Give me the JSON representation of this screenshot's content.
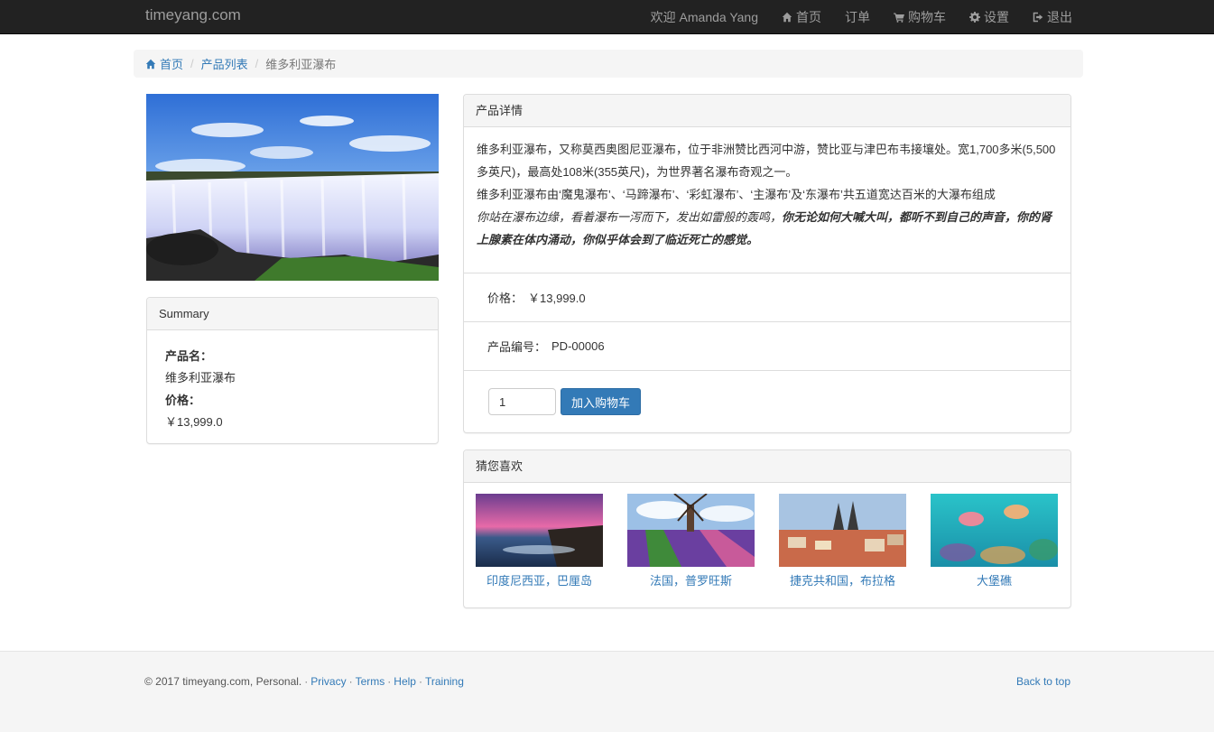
{
  "navbar": {
    "brand": "timeyang.com",
    "welcome": "欢迎 Amanda Yang",
    "home": "首页",
    "orders": "订单",
    "cart": "购物车",
    "settings": "设置",
    "logout": "退出"
  },
  "breadcrumb": {
    "home": "首页",
    "list": "产品列表",
    "current": "维多利亚瀑布"
  },
  "summary": {
    "heading": "Summary",
    "name_label": "产品名：",
    "name_value": "维多利亚瀑布",
    "price_label": "价格：",
    "price_value": "￥13,999.0"
  },
  "detail": {
    "heading": "产品详情",
    "para1": "维多利亚瀑布，又称莫西奥图尼亚瀑布，位于非洲赞比西河中游，赞比亚与津巴布韦接壤处。宽1,700多米(5,500多英尺)，最高处108米(355英尺)，为世界著名瀑布奇观之一。",
    "para2": "维多利亚瀑布由‘魔鬼瀑布’、‘马蹄瀑布’、‘彩虹瀑布’、‘主瀑布’及‘东瀑布’共五道宽达百米的大瀑布组成",
    "para3_italic": "你站在瀑布边缘，看着瀑布一泻而下，发出如雷般的轰鸣，",
    "para3_bold": "你无论如何大喊大叫，都听不到自己的声音，你的肾上腺素在体内涌动，你似乎体会到了临近死亡的感觉。",
    "price_label": "价格：",
    "price_value": "￥13,999.0",
    "code_label": "产品编号：",
    "code_value": "PD-00006",
    "qty_value": "1",
    "add_to_cart": "加入购物车"
  },
  "recommend": {
    "heading": "猜您喜欢",
    "items": [
      {
        "label": "印度尼西亚，巴厘岛"
      },
      {
        "label": "法国，普罗旺斯"
      },
      {
        "label": "捷克共和国，布拉格"
      },
      {
        "label": "大堡礁"
      }
    ]
  },
  "footer": {
    "copyright": "© 2017 timeyang.com, Personal.",
    "privacy": "Privacy",
    "terms": "Terms",
    "help": "Help",
    "training": "Training",
    "back_to_top": "Back to top"
  },
  "colors": {
    "navbar_bg": "#222222",
    "link": "#337ab7",
    "button_primary": "#337ab7"
  },
  "icons": [
    "home-icon",
    "cart-icon",
    "gear-icon",
    "logout-icon"
  ]
}
